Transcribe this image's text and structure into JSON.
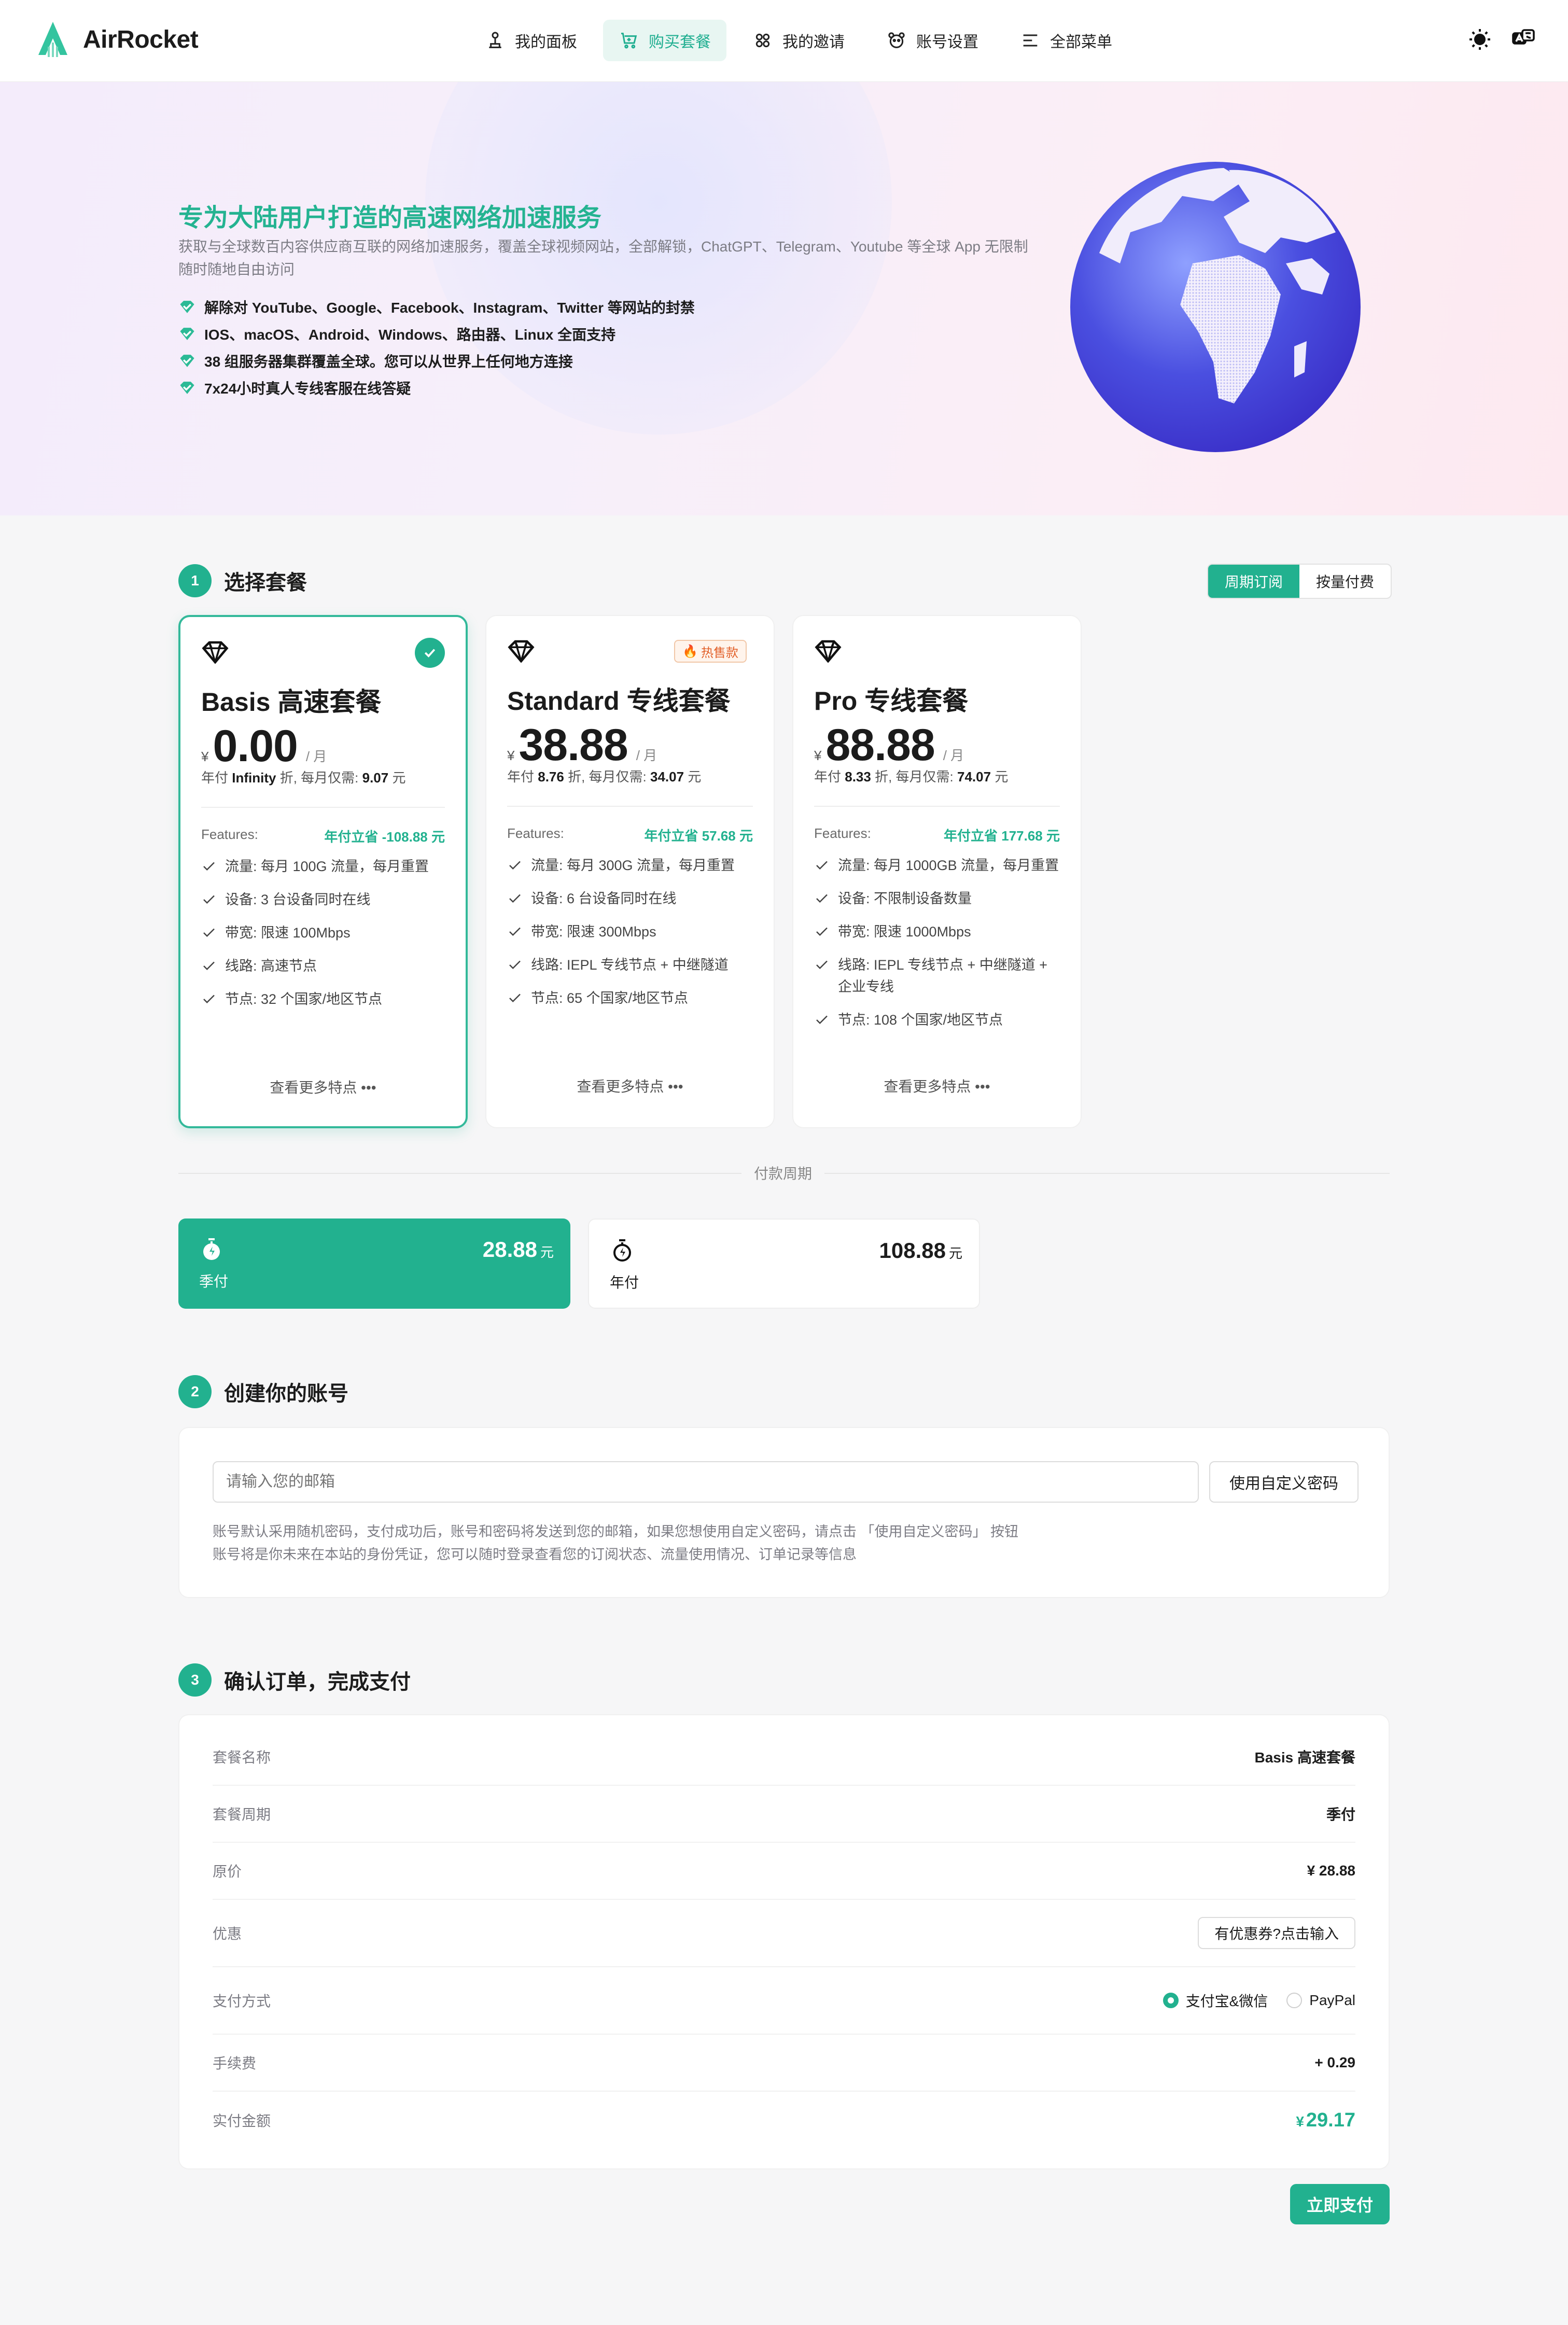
{
  "brand": {
    "name": "AirRocket",
    "accent": "#22b18f"
  },
  "nav": [
    {
      "label": "我的面板",
      "icon": "dashboard-icon",
      "active": false
    },
    {
      "label": "购买套餐",
      "icon": "cart-icon",
      "active": true
    },
    {
      "label": "我的邀请",
      "icon": "invite-icon",
      "active": false
    },
    {
      "label": "账号设置",
      "icon": "account-icon",
      "active": false
    },
    {
      "label": "全部菜单",
      "icon": "menu-icon",
      "active": false
    }
  ],
  "top_actions": [
    "theme-toggle-icon",
    "language-icon"
  ],
  "hero": {
    "title": "专为大陆用户打造的高速网络加速服务",
    "subtitle": "获取与全球数百内容供应商互联的网络加速服务，覆盖全球视频网站，全部解锁，ChatGPT、Telegram、Youtube 等全球 App 无限制随时随地自由访问",
    "points": [
      "解除对 YouTube、Google、Facebook、Instagram、Twitter 等网站的封禁",
      "IOS、macOS、Android、Windows、路由器、Linux 全面支持",
      "38 组服务器集群覆盖全球。您可以从世界上任何地方连接",
      "7x24小时真人专线客服在线答疑"
    ]
  },
  "step1": {
    "num": "1",
    "title": "选择套餐",
    "toggle": [
      "周期订阅",
      "按量付费"
    ],
    "plans": [
      {
        "name": "Basis 高速套餐",
        "currency": "¥",
        "price": "0.00",
        "per": "/ 月",
        "yearly_prefix": "年付",
        "yearly_discount": "Infinity",
        "yearly_mid": "折, 每月仅需:",
        "yearly_monthly": "9.07",
        "yearly_unit": "元",
        "features_label": "Features:",
        "save": "年付立省 -108.88 元",
        "features": [
          "流量: 每月 100G 流量，每月重置",
          "设备: 3 台设备同时在线",
          "带宽: 限速 100Mbps",
          "线路: 高速节点",
          "节点: 32 个国家/地区节点"
        ],
        "more": "查看更多特点 •••",
        "selected": true
      },
      {
        "name": "Standard 专线套餐",
        "currency": "¥",
        "price": "38.88",
        "per": "/ 月",
        "yearly_prefix": "年付",
        "yearly_discount": "8.76",
        "yearly_mid": "折, 每月仅需:",
        "yearly_monthly": "34.07",
        "yearly_unit": "元",
        "badge": "热售款",
        "features_label": "Features:",
        "save": "年付立省 57.68 元",
        "features": [
          "流量: 每月 300G 流量，每月重置",
          "设备: 6 台设备同时在线",
          "带宽: 限速 300Mbps",
          "线路: IEPL 专线节点 + 中继隧道",
          "节点: 65 个国家/地区节点"
        ],
        "more": "查看更多特点 •••"
      },
      {
        "name": "Pro 专线套餐",
        "currency": "¥",
        "price": "88.88",
        "per": "/ 月",
        "yearly_prefix": "年付",
        "yearly_discount": "8.33",
        "yearly_mid": "折, 每月仅需:",
        "yearly_monthly": "74.07",
        "yearly_unit": "元",
        "features_label": "Features:",
        "save": "年付立省 177.68 元",
        "features": [
          "流量: 每月 1000GB 流量，每月重置",
          "设备: 不限制设备数量",
          "带宽: 限速 1000Mbps",
          "线路: IEPL 专线节点 + 中继隧道 + 企业专线",
          "节点: 108 个国家/地区节点"
        ],
        "more": "查看更多特点 •••"
      }
    ],
    "period_label": "付款周期",
    "periods": [
      {
        "label": "季付",
        "price": "28.88",
        "unit": "元",
        "active": true
      },
      {
        "label": "年付",
        "price": "108.88",
        "unit": "元",
        "active": false
      }
    ]
  },
  "step2": {
    "num": "2",
    "title": "创建你的账号",
    "email_placeholder": "请输入您的邮箱",
    "custom_password": "使用自定义密码",
    "hint1": "账号默认采用随机密码，支付成功后，账号和密码将发送到您的邮箱，如果您想使用自定义密码，请点击 「使用自定义密码」 按钮",
    "hint2": "账号将是你未来在本站的身份凭证，您可以随时登录查看您的订阅状态、流量使用情况、订单记录等信息"
  },
  "step3": {
    "num": "3",
    "title": "确认订单，完成支付",
    "rows": {
      "plan_name_k": "套餐名称",
      "plan_name_v": "Basis 高速套餐",
      "period_k": "套餐周期",
      "period_v": "季付",
      "original_k": "原价",
      "original_v": "¥ 28.88",
      "discount_k": "优惠",
      "discount_btn": "有优惠券?点击输入",
      "method_k": "支付方式",
      "method_a": "支付宝&微信",
      "method_b": "PayPal",
      "fee_k": "手续费",
      "fee_v": "+ 0.29",
      "total_k": "实付金额",
      "total_cur": "¥",
      "total_v": "29.17"
    },
    "pay_button": "立即支付"
  }
}
